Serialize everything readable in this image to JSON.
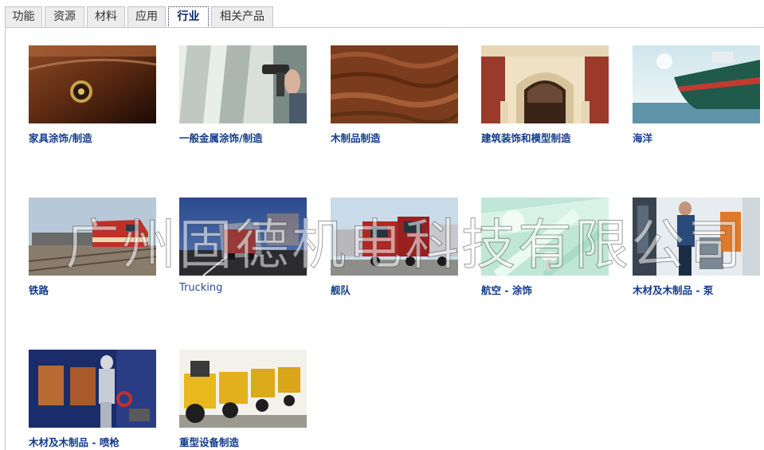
{
  "tabs": [
    {
      "label": "功能",
      "active": false
    },
    {
      "label": "资源",
      "active": false
    },
    {
      "label": "材料",
      "active": false
    },
    {
      "label": "应用",
      "active": false
    },
    {
      "label": "行业",
      "active": true
    },
    {
      "label": "相关产品",
      "active": false
    }
  ],
  "industries": [
    {
      "label": "家具涂饰/制造",
      "image": "furniture-drawer-image"
    },
    {
      "label": "一般金属涂饰/制造",
      "image": "metal-spray-gun-image"
    },
    {
      "label": "木制品制造",
      "image": "wood-grain-image"
    },
    {
      "label": "建筑装饰和模型制造",
      "image": "building-facade-image"
    },
    {
      "label": "海洋",
      "image": "ship-at-sea-image"
    },
    {
      "label": "铁路",
      "image": "locomotive-image"
    },
    {
      "label": "Trucking",
      "image": "truck-on-highway-image"
    },
    {
      "label": "舰队",
      "image": "truck-fleet-image"
    },
    {
      "label": "航空 - 涂饰",
      "image": "aerospace-coating-image"
    },
    {
      "label": "木材及木制品 - 泵",
      "image": "pump-operator-image"
    },
    {
      "label": "木材及木制品 - 喷枪",
      "image": "spray-booth-image"
    },
    {
      "label": "重型设备制造",
      "image": "heavy-equipment-image"
    }
  ],
  "watermark": "广州固德机电科技有限公司",
  "colors": {
    "caption": "#133c8c",
    "tab_active": "#0c2a6b"
  }
}
